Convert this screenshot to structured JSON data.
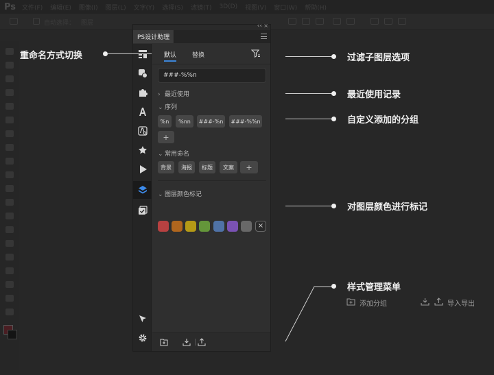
{
  "ps": {
    "logo": "Ps",
    "menu": [
      "文件(F)",
      "编辑(E)",
      "图像(I)",
      "图层(L)",
      "文字(Y)",
      "选择(S)",
      "滤镜(T)",
      "3D(D)",
      "视图(V)",
      "窗口(W)",
      "帮助(H)"
    ],
    "options": {
      "auto_select": "自动选择：",
      "target": "图层"
    }
  },
  "panel": {
    "title": "PS设计助理",
    "tabs": {
      "default": "默认",
      "replace": "替换"
    },
    "name_pattern": "###-%%n",
    "recent_label": "最近使用",
    "sequence": {
      "label": "序列",
      "chips": [
        "%n",
        "%nn",
        "###-%n",
        "###-%%n"
      ],
      "add": "+"
    },
    "common": {
      "label": "常用命名",
      "chips": [
        "背景",
        "海报",
        "标题",
        "文案"
      ],
      "add": "+"
    },
    "layer_colors": {
      "label": "图层颜色标记",
      "colors": [
        "#b84141",
        "#b0661e",
        "#b59a16",
        "#64963a",
        "#4f72a7",
        "#7a52b4",
        "#686868"
      ],
      "clear": "×"
    }
  },
  "annotations": {
    "rename_switch": "重命名方式切换",
    "filter_options": "过滤子图层选项",
    "recent_records": "最近使用记录",
    "custom_groups": "自定义添加的分组",
    "layer_color_tag": "对图层颜色进行标记",
    "style_menu": {
      "title": "样式管理菜单",
      "add_group": "添加分组",
      "import_export": "导入导出"
    }
  }
}
